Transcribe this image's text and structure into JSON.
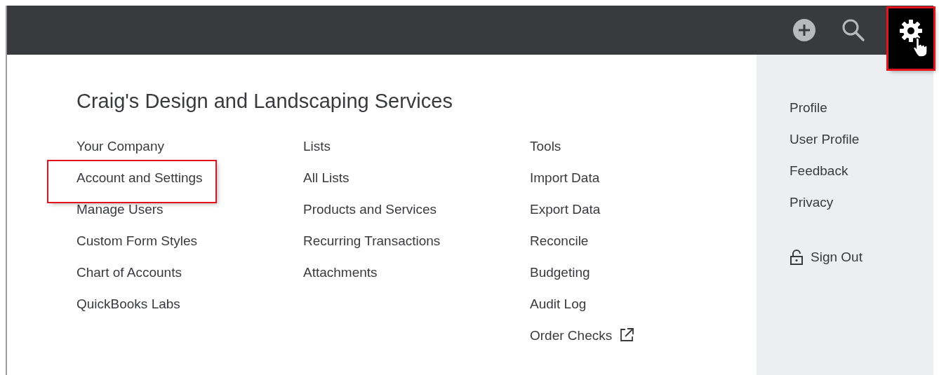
{
  "top_bar": {
    "actions": [
      {
        "kind": "add",
        "highlighted": false
      },
      {
        "kind": "search",
        "highlighted": false
      },
      {
        "kind": "settings",
        "highlighted": true,
        "pointer": true
      }
    ]
  },
  "company_name": "Craig's Design and Landscaping Services",
  "columns": [
    {
      "heading": "Your Company",
      "items": [
        {
          "label": "Account and Settings",
          "highlighted": true
        },
        {
          "label": "Manage Users",
          "highlighted": false
        },
        {
          "label": "Custom Form Styles",
          "highlighted": false
        },
        {
          "label": "Chart of Accounts",
          "highlighted": false
        },
        {
          "label": "QuickBooks Labs",
          "highlighted": false
        }
      ]
    },
    {
      "heading": "Lists",
      "items": [
        {
          "label": "All Lists",
          "highlighted": false
        },
        {
          "label": "Products and Services",
          "highlighted": false
        },
        {
          "label": "Recurring Transactions",
          "highlighted": false
        },
        {
          "label": "Attachments",
          "highlighted": false
        }
      ]
    },
    {
      "heading": "Tools",
      "items": [
        {
          "label": "Import Data",
          "highlighted": false
        },
        {
          "label": "Export Data",
          "highlighted": false
        },
        {
          "label": "Reconcile",
          "highlighted": false
        },
        {
          "label": "Budgeting",
          "highlighted": false
        },
        {
          "label": "Audit Log",
          "highlighted": false
        },
        {
          "label": "Order Checks",
          "highlighted": false,
          "external": true
        }
      ]
    }
  ],
  "profile_panel": {
    "heading": "Profile",
    "items": [
      "User Profile",
      "Feedback",
      "Privacy"
    ],
    "sign_out": "Sign Out"
  }
}
